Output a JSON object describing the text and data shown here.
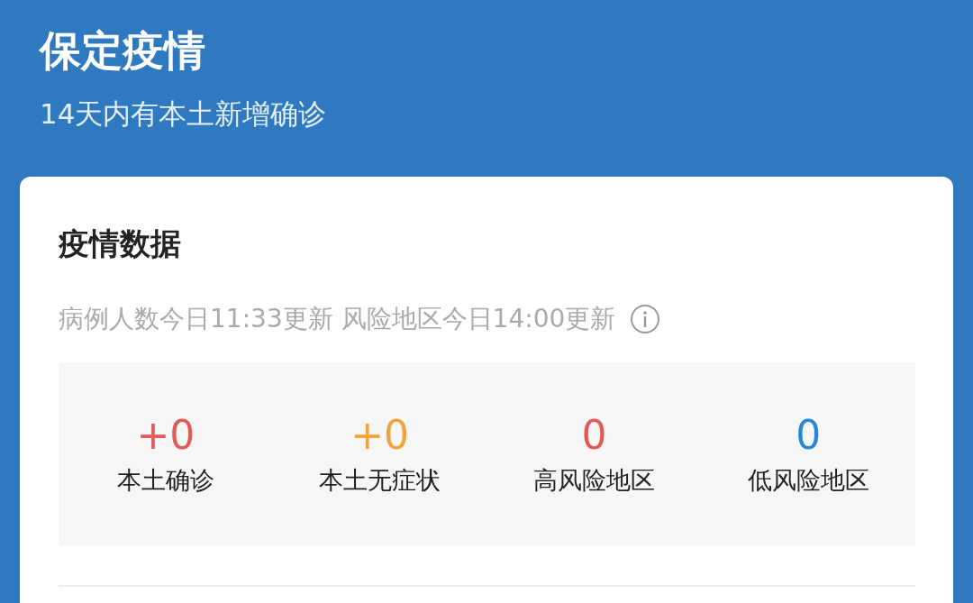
{
  "header": {
    "title": "保定疫情",
    "subtitle": "14天内有本土新增确诊"
  },
  "card": {
    "title": "疫情数据",
    "update_note": "病例人数今日11:33更新 风险地区今日14:00更新",
    "stats": [
      {
        "value": "+0",
        "label": "本土确诊",
        "color": "#e05a58"
      },
      {
        "value": "+0",
        "label": "本土无症状",
        "color": "#f0a33c"
      },
      {
        "value": "0",
        "label": "高风险地区",
        "color": "#e05a58"
      },
      {
        "value": "0",
        "label": "低风险地区",
        "color": "#2a85d8"
      }
    ]
  }
}
